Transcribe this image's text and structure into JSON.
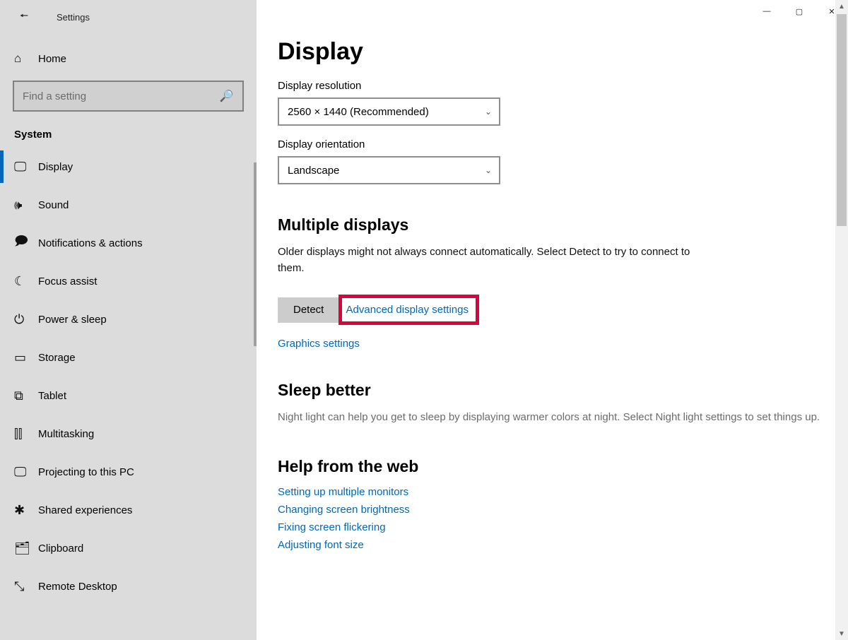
{
  "window": {
    "title": "Settings"
  },
  "sidebar": {
    "home_label": "Home",
    "search_placeholder": "Find a setting",
    "section_label": "System",
    "items": [
      {
        "icon": "display",
        "label": "Display",
        "active": true
      },
      {
        "icon": "sound",
        "label": "Sound",
        "active": false
      },
      {
        "icon": "notif",
        "label": "Notifications & actions",
        "active": false
      },
      {
        "icon": "focus",
        "label": "Focus assist",
        "active": false
      },
      {
        "icon": "power",
        "label": "Power & sleep",
        "active": false
      },
      {
        "icon": "storage",
        "label": "Storage",
        "active": false
      },
      {
        "icon": "tablet",
        "label": "Tablet",
        "active": false
      },
      {
        "icon": "multitask",
        "label": "Multitasking",
        "active": false
      },
      {
        "icon": "projecting",
        "label": "Projecting to this PC",
        "active": false
      },
      {
        "icon": "shared",
        "label": "Shared experiences",
        "active": false
      },
      {
        "icon": "clipboard",
        "label": "Clipboard",
        "active": false
      },
      {
        "icon": "remote",
        "label": "Remote Desktop",
        "active": false
      }
    ]
  },
  "main": {
    "page_title": "Display",
    "resolution": {
      "label": "Display resolution",
      "value": "2560 × 1440 (Recommended)"
    },
    "orientation": {
      "label": "Display orientation",
      "value": "Landscape"
    },
    "multiple_displays": {
      "heading": "Multiple displays",
      "desc": "Older displays might not always connect automatically. Select Detect to try to connect to them.",
      "detect_button": "Detect",
      "adv_link": "Advanced display settings",
      "graphics_link": "Graphics settings"
    },
    "sleep_better": {
      "heading": "Sleep better",
      "desc": "Night light can help you get to sleep by displaying warmer colors at night. Select Night light settings to set things up."
    },
    "help_from_web": {
      "heading": "Help from the web",
      "links": [
        "Setting up multiple monitors",
        "Changing screen brightness",
        "Fixing screen flickering",
        "Adjusting font size"
      ]
    }
  },
  "icons": {
    "home": "⌂",
    "display": "🖵",
    "sound": "🕪",
    "notif": "🗩",
    "focus": "☾",
    "power": "⏻",
    "storage": "▭",
    "tablet": "⧉",
    "multitask": "⫿⫿",
    "projecting": "🖵",
    "shared": "✱",
    "clipboard": "🗂",
    "remote": "⤡",
    "back": "🠔",
    "search": "🔍",
    "chevron": "⌄",
    "minimize": "—",
    "maximize": "▢",
    "close": "✕"
  }
}
